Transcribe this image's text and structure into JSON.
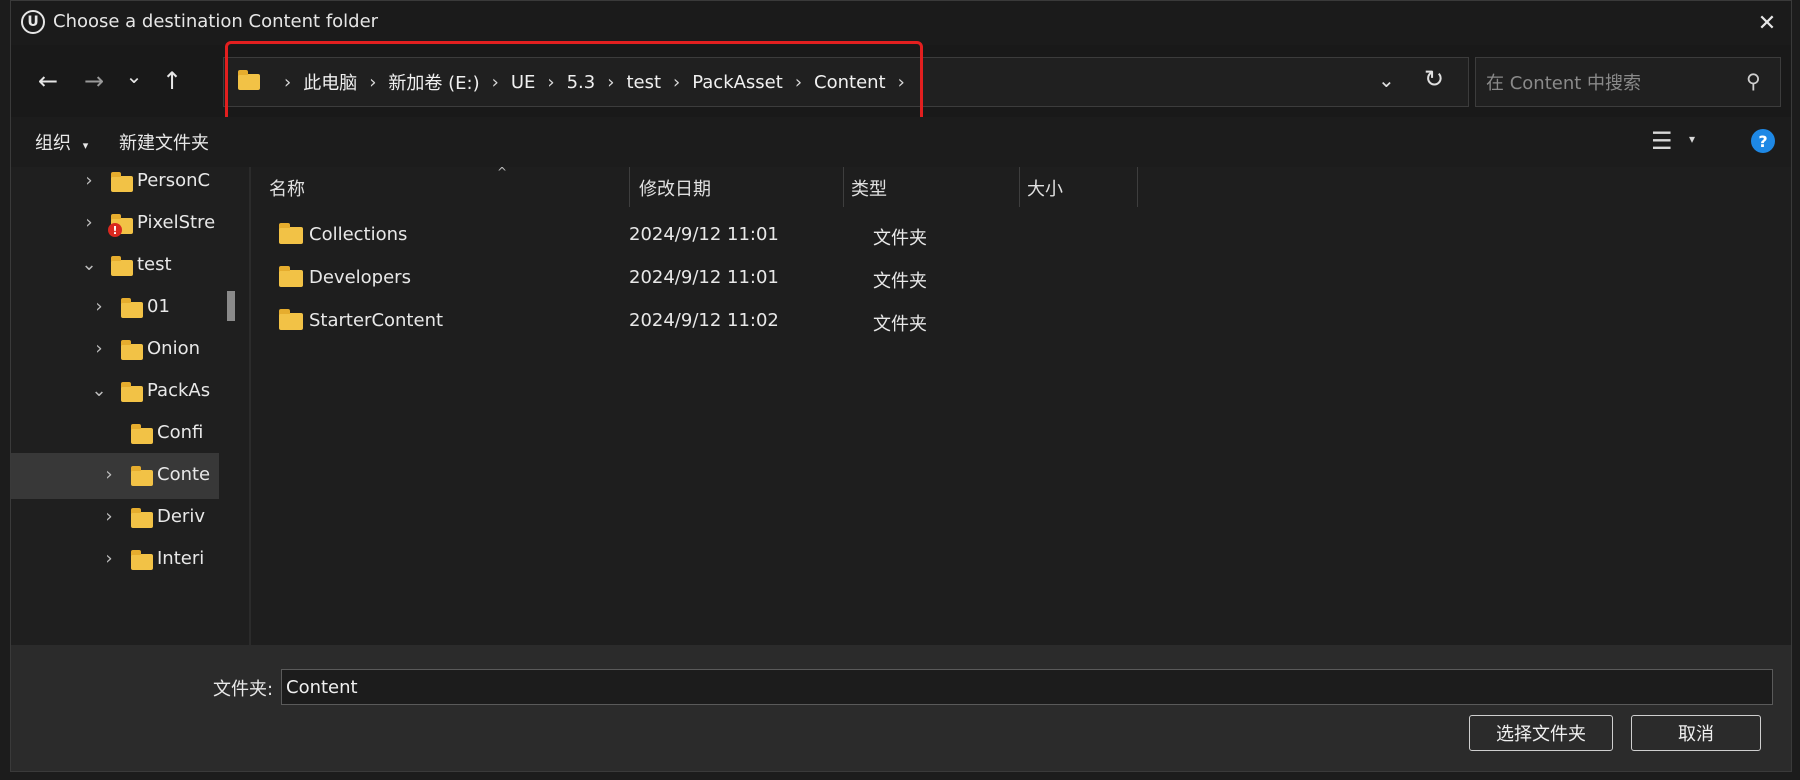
{
  "window": {
    "title": "Choose a destination Content folder"
  },
  "nav": {
    "back": "←",
    "forward": "→",
    "recent": "⌄",
    "up": "↑",
    "breadcrumbs": [
      "此电脑",
      "新加卷 (E:)",
      "UE",
      "5.3",
      "test",
      "PackAsset",
      "Content"
    ],
    "separator": "›"
  },
  "search": {
    "placeholder": "在 Content 中搜索",
    "value": ""
  },
  "toolbar": {
    "organize": "组织",
    "new_folder": "新建文件夹",
    "help": "?"
  },
  "tree": {
    "items": [
      {
        "label": "PersonC",
        "chev": "›",
        "warning": false
      },
      {
        "label": "PixelStre",
        "chev": "›",
        "warning": true
      },
      {
        "label": "test",
        "chev": "⌄",
        "warning": false
      },
      {
        "label": "01",
        "chev": "›",
        "warning": false
      },
      {
        "label": "Onion",
        "chev": "›",
        "warning": false
      },
      {
        "label": "PackAs",
        "chev": "⌄",
        "warning": false
      },
      {
        "label": "Confi",
        "chev": "",
        "warning": false
      },
      {
        "label": "Conte",
        "chev": "›",
        "warning": false
      },
      {
        "label": "Deriv",
        "chev": "›",
        "warning": false
      },
      {
        "label": "Interi",
        "chev": "›",
        "warning": false
      }
    ]
  },
  "list": {
    "columns": [
      "名称",
      "修改日期",
      "类型",
      "大小"
    ],
    "rows": [
      {
        "name": "Collections",
        "date": "2024/9/12 11:01",
        "type": "文件夹",
        "size": ""
      },
      {
        "name": "Developers",
        "date": "2024/9/12 11:01",
        "type": "文件夹",
        "size": ""
      },
      {
        "name": "StarterContent",
        "date": "2024/9/12 11:02",
        "type": "文件夹",
        "size": ""
      }
    ]
  },
  "footer": {
    "folder_label": "文件夹:",
    "folder_value": "Content",
    "select_button": "选择文件夹",
    "cancel_button": "取消"
  },
  "colors": {
    "accent_red": "#e21f1f",
    "folder": "#f2c246",
    "help_blue": "#1e88e5"
  }
}
